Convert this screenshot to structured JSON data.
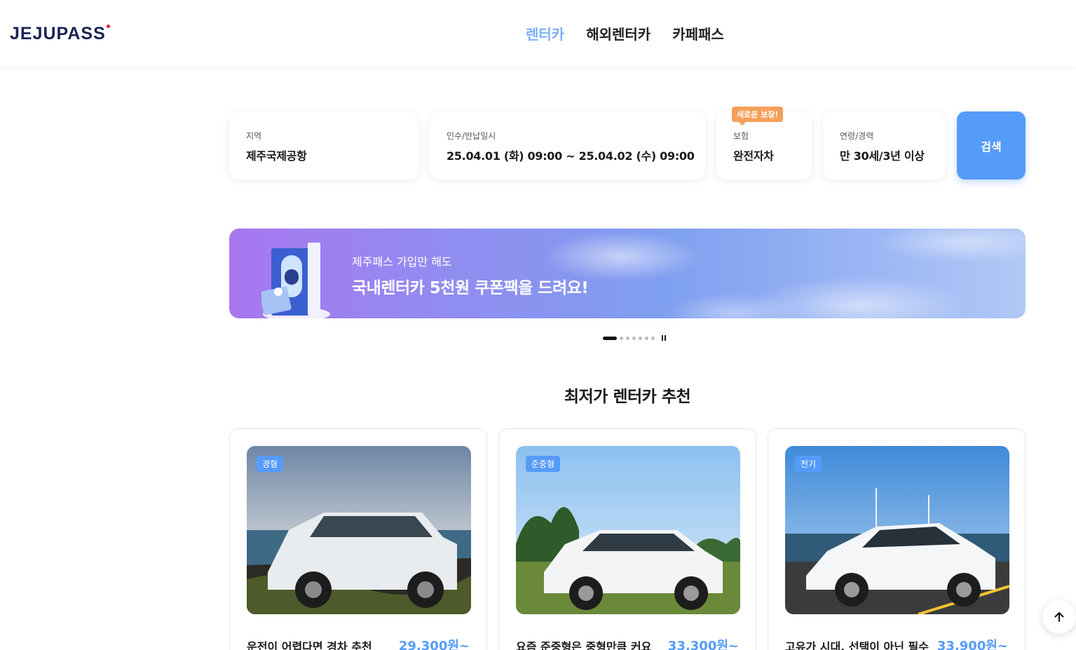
{
  "header": {
    "logo": "JEJUPASS",
    "nav": [
      {
        "label": "렌터카",
        "active": true
      },
      {
        "label": "해외렌터카",
        "active": false
      },
      {
        "label": "카페패스",
        "active": false
      }
    ]
  },
  "search": {
    "region": {
      "label": "지역",
      "value": "제주국제공항"
    },
    "datetime": {
      "label": "인수/반납일시",
      "value": "25.04.01 (화) 09:00 ~ 25.04.02 (수) 09:00"
    },
    "insurance": {
      "badge": "새로운 보장!",
      "label": "보험",
      "value": "완전자차"
    },
    "age": {
      "label": "연령/경력",
      "value": "만 30세/3년 이상"
    },
    "button": "검색"
  },
  "banner": {
    "subtitle": "제주패스 가입만 해도",
    "title": "국내렌터카 5천원 쿠폰팩을 드려요!",
    "slide_count": 7,
    "current_slide": 1
  },
  "section": {
    "title": "최저가 렌터카 추천"
  },
  "cards": [
    {
      "tag": "경형",
      "title": "운전이 어렵다면 경차 추천",
      "price": "29,300원~"
    },
    {
      "tag": "준중형",
      "title": "요즘 준중형은 중형만큼 커요",
      "price": "33,300원~"
    },
    {
      "tag": "전기",
      "title": "고유가 시대, 선택이 아닌 필수",
      "price": "33,900원~"
    }
  ],
  "colors": {
    "accent": "#559bf9",
    "nav_active": "#7aaef5",
    "badge": "#f5a05a",
    "logo": "#1b2456"
  }
}
